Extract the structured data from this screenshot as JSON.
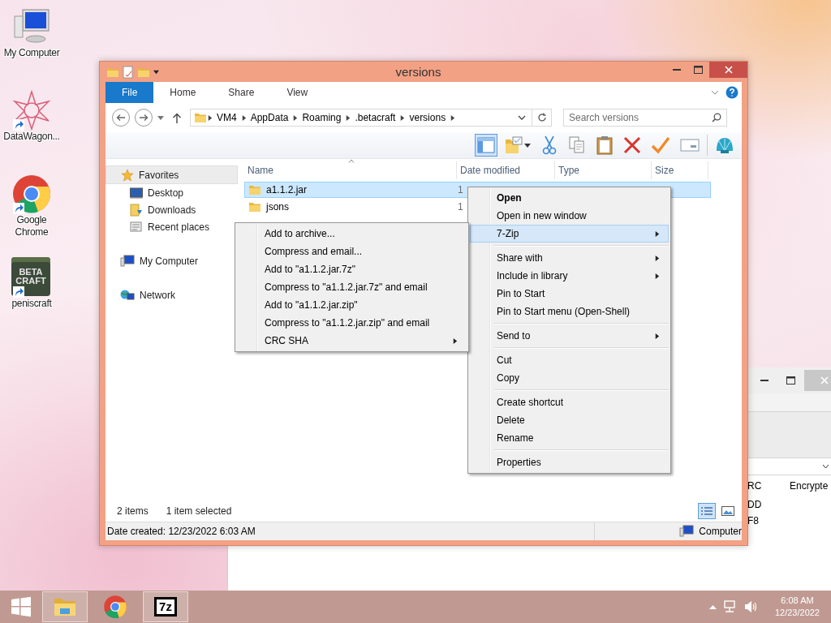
{
  "desktop_icons": [
    {
      "label": "My Computer",
      "kind": "computer",
      "shortcut": false
    },
    {
      "label": "DataWagon...",
      "kind": "star",
      "shortcut": true
    },
    {
      "label": "Google Chrome",
      "kind": "chrome",
      "shortcut": true
    },
    {
      "label": "peniscraft",
      "kind": "block",
      "shortcut": true,
      "logo_text": [
        "BETA",
        "CRAFT"
      ]
    }
  ],
  "explorer": {
    "title": "versions",
    "ribbon_tabs": [
      {
        "label": "File",
        "kind": "file",
        "selected": false
      },
      {
        "label": "Home",
        "kind": "tab",
        "selected": false
      },
      {
        "label": "Share",
        "kind": "tab",
        "selected": false
      },
      {
        "label": "View",
        "kind": "tab",
        "selected": false
      }
    ],
    "path": [
      "VM4",
      "AppData",
      "Roaming",
      ".betacraft",
      "versions"
    ],
    "search": {
      "placeholder": "Search versions"
    },
    "preview_pane": {
      "on": true
    },
    "nav": [
      {
        "label": "Favorites",
        "kind": "favorites",
        "selected": true,
        "children": [
          {
            "label": "Desktop",
            "kind": "desktop",
            "selected": false
          },
          {
            "label": "Downloads",
            "kind": "downloads",
            "selected": false
          },
          {
            "label": "Recent places",
            "kind": "recent",
            "selected": false
          }
        ]
      },
      {
        "label": "My Computer",
        "kind": "computer",
        "selected": false
      },
      {
        "label": "Network",
        "kind": "network",
        "selected": false
      }
    ],
    "columns": [
      "Name",
      "Date modified",
      "Type",
      "Size"
    ],
    "files": [
      {
        "name": "a1.1.2.jar",
        "date_modified": "1",
        "selected": true
      },
      {
        "name": "jsons",
        "date_modified": "1",
        "selected": false
      }
    ],
    "item_count": "2 items",
    "selection_count": "1 item selected",
    "views": [
      {
        "kind": "details",
        "selected": true
      },
      {
        "kind": "thumbnails",
        "selected": false
      }
    ],
    "details_text": "Date created: 12/23/2022 6:03 AM",
    "zone": "Computer"
  },
  "context_menu": [
    [
      {
        "label": "Open",
        "default": true,
        "submenu": false,
        "selected": false
      },
      {
        "label": "Open in new window",
        "default": false,
        "submenu": false,
        "selected": false
      },
      {
        "label": "7-Zip",
        "default": false,
        "submenu": true,
        "selected": true
      }
    ],
    [
      {
        "label": "Share with",
        "default": false,
        "submenu": true,
        "selected": false
      },
      {
        "label": "Include in library",
        "default": false,
        "submenu": true,
        "selected": false
      },
      {
        "label": "Pin to Start",
        "default": false,
        "submenu": false,
        "selected": false
      },
      {
        "label": "Pin to Start menu (Open-Shell)",
        "default": false,
        "submenu": false,
        "selected": false
      }
    ],
    [
      {
        "label": "Send to",
        "default": false,
        "submenu": true,
        "selected": false
      }
    ],
    [
      {
        "label": "Cut",
        "default": false,
        "submenu": false,
        "selected": false
      },
      {
        "label": "Copy",
        "default": false,
        "submenu": false,
        "selected": false
      }
    ],
    [
      {
        "label": "Create shortcut",
        "default": false,
        "submenu": false,
        "selected": false
      },
      {
        "label": "Delete",
        "default": false,
        "submenu": false,
        "selected": false
      },
      {
        "label": "Rename",
        "default": false,
        "submenu": false,
        "selected": false
      }
    ],
    [
      {
        "label": "Properties",
        "default": false,
        "submenu": false,
        "selected": false
      }
    ]
  ],
  "submenu": [
    {
      "label": "Add to archive...",
      "submenu": false,
      "selected": false
    },
    {
      "label": "Compress and email...",
      "submenu": false,
      "selected": false
    },
    {
      "label": "Add to \"a1.1.2.jar.7z\"",
      "submenu": false,
      "selected": false
    },
    {
      "label": "Compress to \"a1.1.2.jar.7z\" and email",
      "submenu": false,
      "selected": false
    },
    {
      "label": "Add to \"a1.1.2.jar.zip\"",
      "submenu": false,
      "selected": false
    },
    {
      "label": "Compress to \"a1.1.2.jar.zip\" and email",
      "submenu": false,
      "selected": false
    },
    {
      "label": "CRC SHA",
      "submenu": true,
      "selected": false
    }
  ],
  "background_window": {
    "column_1": "RC",
    "column_2": "Encrypte",
    "rows": [
      "DD",
      "F8"
    ]
  },
  "taskbar": {
    "apps": [
      {
        "kind": "explorer",
        "running": true
      },
      {
        "kind": "chrome",
        "running": false
      },
      {
        "kind": "sevenzip",
        "label": "7z",
        "running": true
      }
    ],
    "time": "6:08 AM",
    "date": "12/23/2022"
  }
}
